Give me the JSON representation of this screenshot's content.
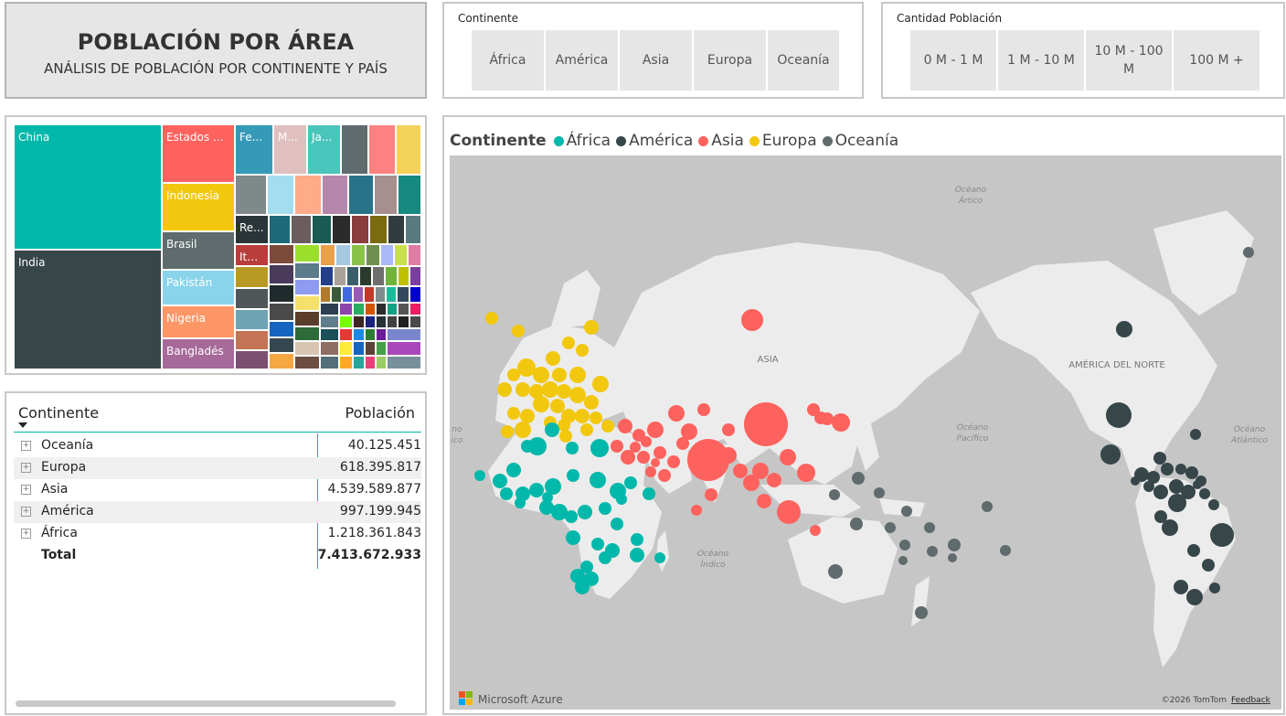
{
  "header": {
    "title": "POBLACIÓN POR ÁREA",
    "subtitle": "ANÁLISIS DE POBLACIÓN POR CONTINENTE Y PAÍS"
  },
  "continent_slicer": {
    "title": "Continente",
    "options": [
      "África",
      "América",
      "Asia",
      "Europa",
      "Oceanía"
    ]
  },
  "population_slicer": {
    "title": "Cantidad Población",
    "options": [
      "0 M - 1 M",
      "1 M - 10 M",
      "10 M - 100 M",
      "100 M +"
    ]
  },
  "treemap": {
    "labels": {
      "china": "China",
      "india": "India",
      "usa": "Estados U...",
      "indonesia": "Indonesia",
      "brasil": "Brasil",
      "pakistan": "Pakistán",
      "nigeria": "Nigeria",
      "banglades": "Bangladés",
      "fe": "Fe...",
      "m": "M...",
      "ja": "Ja...",
      "re": "Re...",
      "ita": "Ita..."
    },
    "colors": {
      "china": "#01b8aa",
      "india": "#374649",
      "usa": "#fd625e",
      "indonesia": "#f2c80f",
      "brasil": "#5f6b6d",
      "pakistan": "#8ad4eb",
      "nigeria": "#fe9666",
      "banglades": "#a66999"
    }
  },
  "table": {
    "col_continent": "Continente",
    "col_population": "Población",
    "rows": [
      {
        "name": "Oceanía",
        "value": "40.125.451"
      },
      {
        "name": "Europa",
        "value": "618.395.817"
      },
      {
        "name": "Asia",
        "value": "4.539.589.877"
      },
      {
        "name": "América",
        "value": "997.199.945"
      },
      {
        "name": "África",
        "value": "1.218.361.843"
      }
    ],
    "total_label": "Total",
    "total_value": "7.413.672.933"
  },
  "map": {
    "legend_title": "Continente",
    "legend": [
      {
        "name": "África",
        "color": "#01b8aa"
      },
      {
        "name": "América",
        "color": "#374649"
      },
      {
        "name": "Asia",
        "color": "#fd625e"
      },
      {
        "name": "Europa",
        "color": "#f2c80f"
      },
      {
        "name": "Oceanía",
        "color": "#5f6b6d"
      }
    ],
    "labels": {
      "artic": "Océano Ártico",
      "asia": "ASIA",
      "north_america": "AMÉRICA DEL NORTE",
      "pacific_left": "Océano Pacífico",
      "pacific": "Océano Pacífico",
      "atlantic": "Océano Atlántico",
      "indian": "Océano Índico"
    },
    "brand": "Microsoft Azure",
    "copyright": "©2026 TomTom",
    "feedback": "Feedback"
  }
}
